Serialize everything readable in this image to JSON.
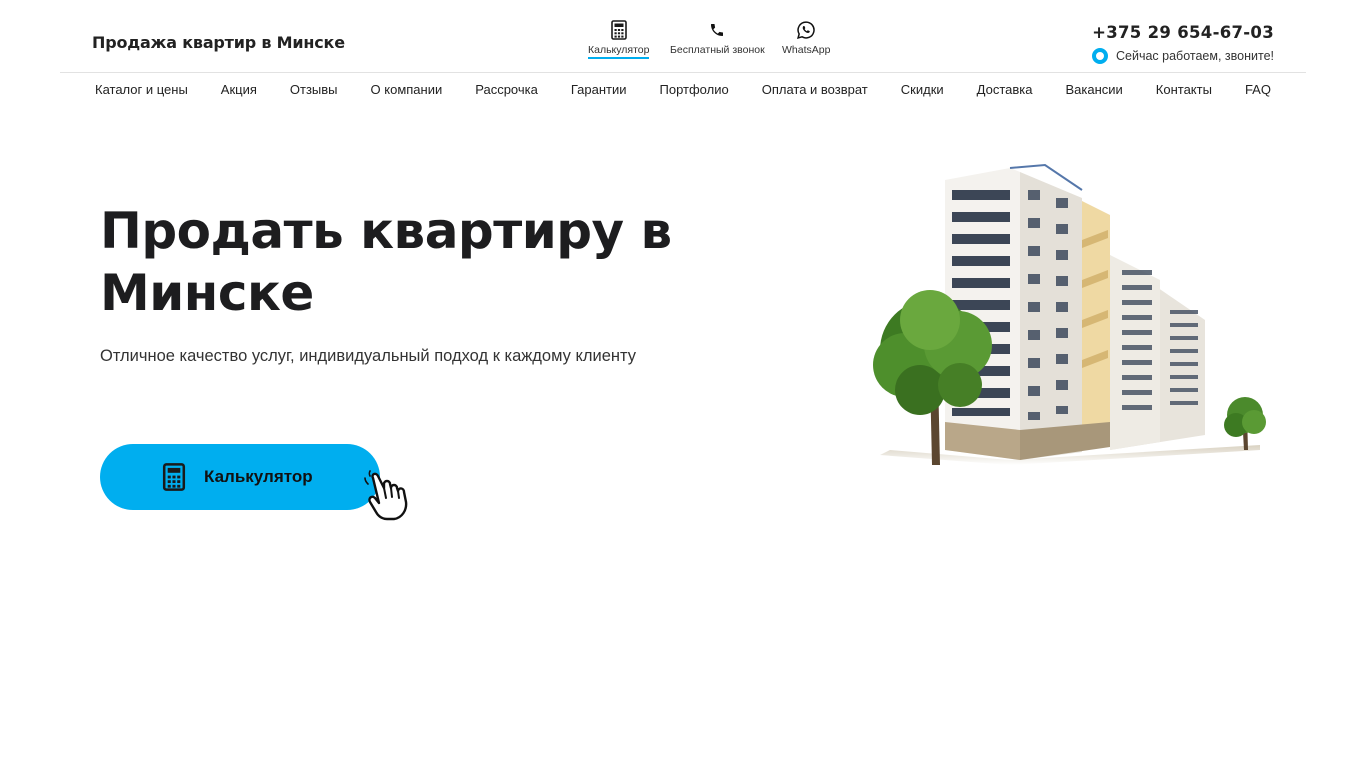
{
  "header": {
    "logo": "Продажа квартир в Минске",
    "quick_links": [
      {
        "label": "Калькулятор",
        "icon": "calculator-icon"
      },
      {
        "label": "Бесплатный звонок",
        "icon": "phone-icon"
      },
      {
        "label": "WhatsApp",
        "icon": "whatsapp-icon"
      }
    ],
    "phone": "+375 29 654-67-03",
    "status": "Сейчас работаем, звоните!"
  },
  "nav": {
    "items": [
      "Каталог и цены",
      "Акция",
      "Отзывы",
      "О компании",
      "Рассрочка",
      "Гарантии",
      "Портфолио",
      "Оплата и возврат",
      "Скидки",
      "Доставка",
      "Вакансии",
      "Контакты",
      "FAQ"
    ]
  },
  "hero": {
    "title": "Продать квартиру в Минске",
    "subtitle": "Отличное качество услуг, индивидуальный подход к каждому клиенту",
    "cta_label": "Калькулятор"
  },
  "colors": {
    "accent": "#00aeef",
    "text": "#1d1d1f"
  }
}
